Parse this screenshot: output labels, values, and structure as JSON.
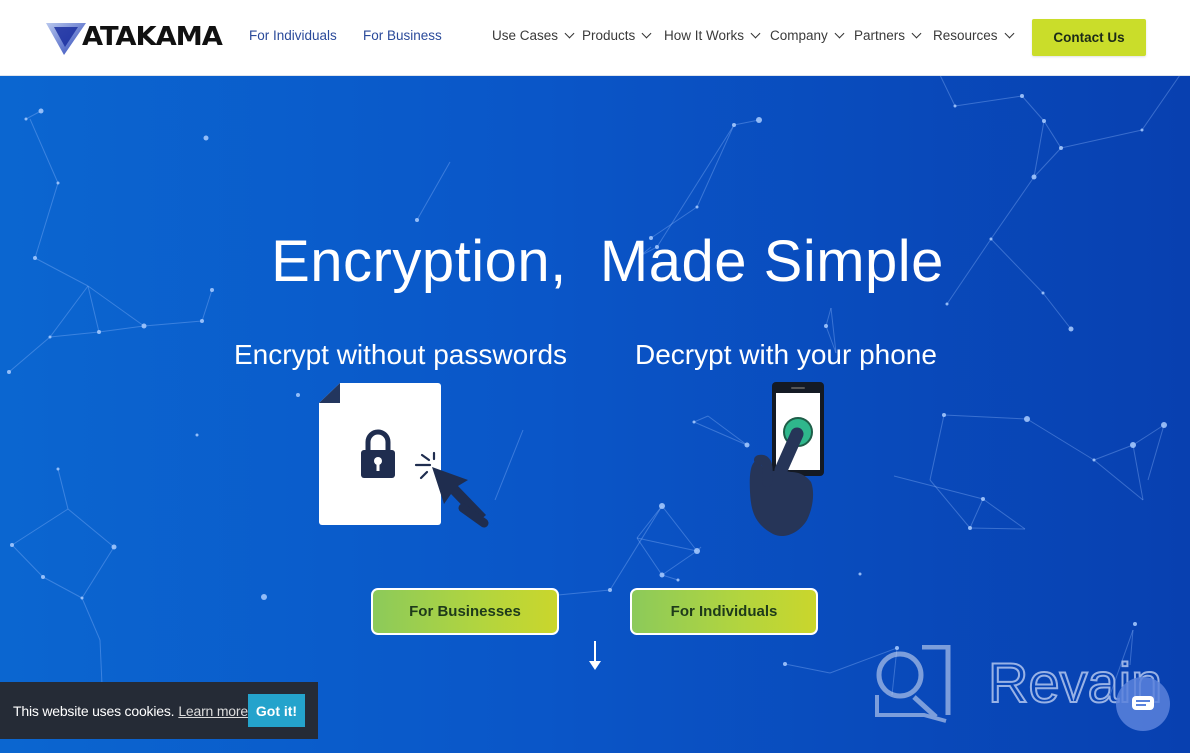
{
  "brand": {
    "name": "ATAKAMA",
    "accent_color": "#cadd2a",
    "hero_bg": "#0a56c8"
  },
  "header": {
    "left_links": [
      {
        "label": "For Individuals"
      },
      {
        "label": "For Business"
      }
    ],
    "menu": [
      {
        "label": "Use Cases",
        "has_dropdown": true
      },
      {
        "label": "Products",
        "has_dropdown": true
      },
      {
        "label": "How It Works",
        "has_dropdown": true
      },
      {
        "label": "Company",
        "has_dropdown": true
      },
      {
        "label": "Partners",
        "has_dropdown": true
      },
      {
        "label": "Resources",
        "has_dropdown": true
      }
    ],
    "contact_label": "Contact Us"
  },
  "hero": {
    "title": "Encryption,  Made Simple",
    "left_feature": {
      "label": "Encrypt without passwords",
      "icon": "locked-document-click-icon"
    },
    "right_feature": {
      "label": "Decrypt with your phone",
      "icon": "phone-tap-icon"
    },
    "cta_buttons": [
      {
        "label": "For Businesses"
      },
      {
        "label": "For Individuals"
      }
    ],
    "scroll_icon": "arrow-down-icon"
  },
  "cookie_banner": {
    "text": "This website uses cookies.",
    "link_label": "Learn more",
    "button_label": "Got it!"
  },
  "watermark": {
    "text": "Revain"
  }
}
